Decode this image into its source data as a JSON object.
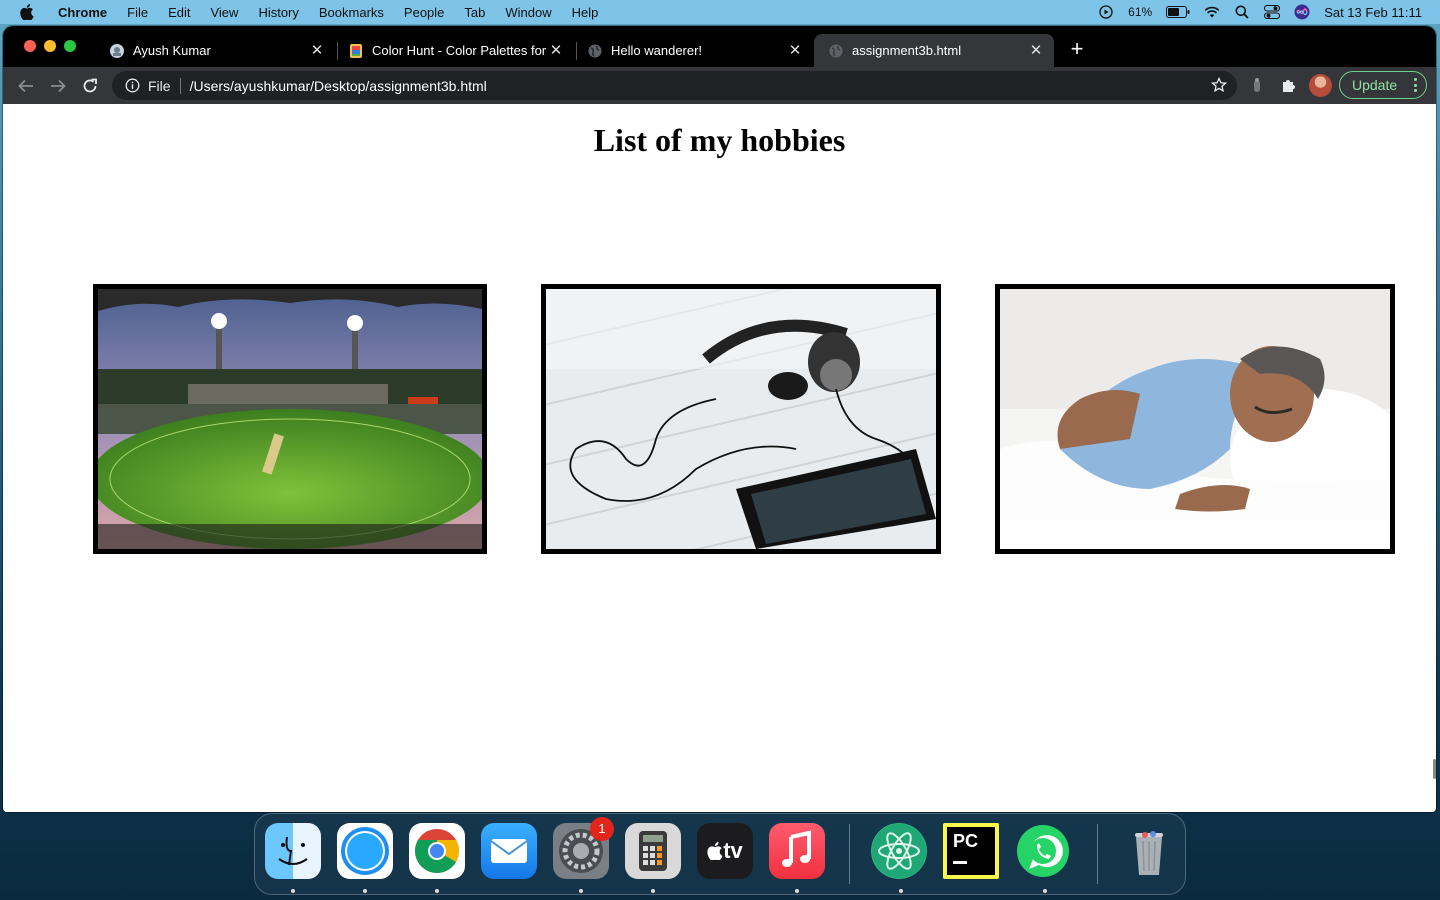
{
  "menubar": {
    "app_name": "Chrome",
    "items": [
      "File",
      "Edit",
      "View",
      "History",
      "Bookmarks",
      "People",
      "Tab",
      "Window",
      "Help"
    ],
    "battery": "61%",
    "datetime": "Sat 13 Feb  11:11"
  },
  "tabs": [
    {
      "title": "Ayush Kumar",
      "close": "✕",
      "active": false
    },
    {
      "title": "Color Hunt - Color Palettes for",
      "close": "✕",
      "active": false
    },
    {
      "title": "Hello wanderer!",
      "close": "✕",
      "active": false
    },
    {
      "title": "assignment3b.html",
      "close": "✕",
      "active": true
    }
  ],
  "new_tab": "+",
  "address_bar": {
    "scheme": "File",
    "url": "/Users/ayushkumar/Desktop/assignment3b.html"
  },
  "update_button": "Update",
  "page": {
    "heading": "List of my hobbies",
    "hobbies": [
      {
        "name": "cricket-stadium-image"
      },
      {
        "name": "headphones-phone-image"
      },
      {
        "name": "sleeping-man-image"
      }
    ]
  },
  "dock": {
    "apps": [
      "Finder",
      "Safari",
      "Google Chrome",
      "Mail",
      "System Preferences",
      "Calculator",
      "TV",
      "Music",
      "Atom",
      "PyCharm",
      "WhatsApp",
      "Trash"
    ],
    "system_preferences_badge": "1",
    "tv_label": "tv",
    "pycharm_label": "PC"
  },
  "colors": {
    "menubar_bg": "#7ec4e8",
    "tabstrip_bg": "#000000",
    "toolbar_bg": "#35363a",
    "update_accent": "#8ee0a5",
    "badge_red": "#e3251b"
  }
}
